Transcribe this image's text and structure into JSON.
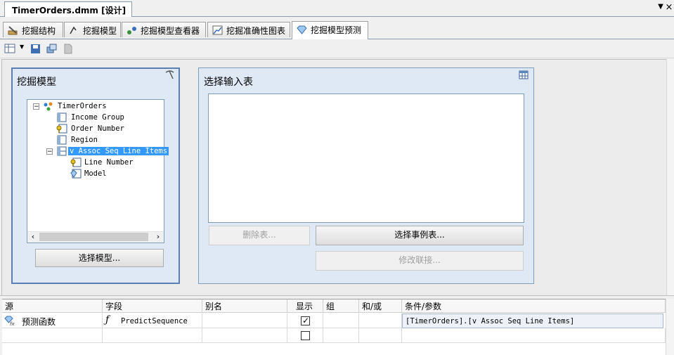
{
  "document": {
    "tab_title": "TimerOrders.dmm [设计]"
  },
  "designer_tabs": [
    {
      "label": "挖掘结构",
      "icon": "mining-structure-icon"
    },
    {
      "label": "挖掘模型",
      "icon": "mining-model-icon"
    },
    {
      "label": "挖掘模型查看器",
      "icon": "model-viewer-icon"
    },
    {
      "label": "挖掘准确性图表",
      "icon": "accuracy-chart-icon"
    },
    {
      "label": "挖掘模型预测",
      "icon": "prediction-icon",
      "active": true
    }
  ],
  "model_panel": {
    "title": "挖掘模型",
    "tree": [
      {
        "label": "TimerOrders",
        "icon": "mining-model-icon",
        "expanded": true
      },
      {
        "label": "Income Group",
        "icon": "column-icon"
      },
      {
        "label": "Order Number",
        "icon": "key-column-icon"
      },
      {
        "label": "Region",
        "icon": "column-icon"
      },
      {
        "label": "v Assoc Seq Line Items",
        "icon": "nested-table-icon",
        "expanded": true,
        "selected": true
      },
      {
        "label": "Line Number",
        "icon": "key-column-icon"
      },
      {
        "label": "Model",
        "icon": "predictable-column-icon"
      }
    ],
    "select_button": "选择模型..."
  },
  "input_panel": {
    "title": "选择输入表",
    "remove_button": "删除表...",
    "select_case_button": "选择事例表...",
    "modify_join_button": "修改联接..."
  },
  "grid": {
    "headers": [
      "源",
      "字段",
      "别名",
      "显示",
      "组",
      "和/或",
      "条件/参数"
    ],
    "rows": [
      {
        "source": "预测函数",
        "field": "PredictSequence",
        "alias": "",
        "show": true,
        "group": "",
        "andor": "",
        "criteria": "[TimerOrders].[v Assoc Seq Line Items]"
      },
      {
        "source": "",
        "field": "",
        "alias": "",
        "show": false,
        "group": "",
        "andor": "",
        "criteria": ""
      }
    ]
  },
  "colors": {
    "selection": "#3399ff",
    "panel_border": "#5a7fb3",
    "panel_bg": "#dfe9f6"
  }
}
